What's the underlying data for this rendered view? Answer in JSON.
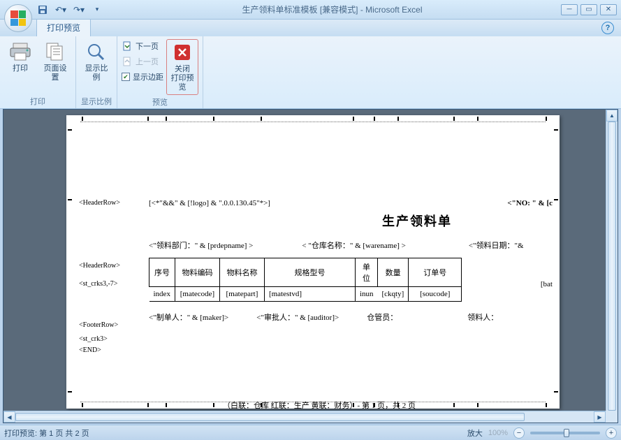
{
  "title": "生产领料单标准模板  [兼容模式] - Microsoft Excel",
  "tab": "打印预览",
  "ribbon": {
    "g1": {
      "print": "打印",
      "setup": "页面设置",
      "label": "打印"
    },
    "g2": {
      "zoom": "显示比例",
      "label": "显示比例"
    },
    "g3": {
      "next": "下一页",
      "prev": "上一页",
      "margins": "显示边距",
      "close1": "关闭",
      "close2": "打印预览",
      "label": "预览"
    }
  },
  "doc": {
    "headerRow": "<HeaderRow>",
    "headerExpr": "[<*\"&&\" & [!logo] & \".0.0.130.45\"*>]",
    "noExpr": "<\"NO: \" & [c",
    "title": "生产领料单",
    "dept": "<\"领料部门：\" & [prdepname] >",
    "ware": "< \"仓库名称：\" & [warename] >",
    "date": "<\"领料日期：\"&",
    "cols": {
      "c1": "序号",
      "c2": "物料编码",
      "c3": "物料名称",
      "c4": "规格型号",
      "c5": "单位",
      "c6": "数量",
      "c7": "订单号"
    },
    "rowMarker": "<st_crks3,-7>",
    "cells": {
      "d1": "index",
      "d2": "[matecode]",
      "d3": "[matepart]",
      "d4": "[matestvd]",
      "d5": "inun",
      "d6": "[ckqty]",
      "d7": "[soucode]",
      "d8": "[bat"
    },
    "footerRow": "<FooterRow>",
    "maker": "<\"制单人：\" & [maker]>",
    "auditor": "<\"审批人：\" & [auditor]>",
    "keeper": "仓管员：",
    "picker": "领料人：",
    "stMarker": "<st_crk3>",
    "endMarker": "<END>",
    "pageFoot": "（白联：仓库  红联：生产  黄联：财务）- 第 1 页，共 2 页"
  },
  "status": {
    "left": "打印预览: 第 1 页  共 2 页",
    "zoomLabel": "放大",
    "zoomPct": "100%"
  }
}
